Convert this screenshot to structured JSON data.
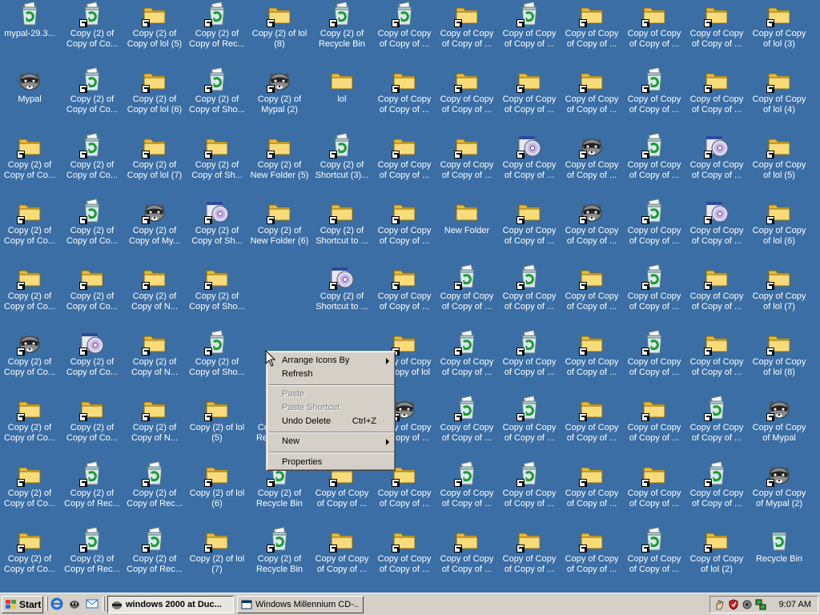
{
  "desktop": {
    "background_color": "#3a6ea5",
    "grid": [
      [
        [
          "recycle_full",
          "mypal-29.3...",
          false
        ],
        [
          "recycle_full",
          "Copy (2) of Copy of Co...",
          true
        ],
        [
          "folder",
          "Copy (2) of Copy of lol (5)",
          true
        ],
        [
          "recycle_full",
          "Copy (2) of Copy of Rec...",
          true
        ],
        [
          "folder",
          "Copy (2) of lol (8)",
          true
        ],
        [
          "recycle_full",
          "Copy (2) of Recycle Bin (8)",
          true
        ],
        [
          "recycle_full",
          "Copy of Copy of Copy of ...",
          true
        ],
        [
          "folder",
          "Copy of Copy of Copy of ...",
          true
        ],
        [
          "recycle_full",
          "Copy of Copy of Copy of ...",
          true
        ],
        [
          "folder",
          "Copy of Copy of Copy of ...",
          true
        ],
        [
          "folder",
          "Copy of Copy of Copy of ...",
          true
        ],
        [
          "folder",
          "Copy of Copy of Copy of ...",
          true
        ],
        [
          "folder",
          "Copy of Copy of lol (3)",
          true
        ]
      ],
      [
        [
          "raccoon",
          "Mypal",
          false
        ],
        [
          "recycle_full",
          "Copy (2) of Copy of Co...",
          true
        ],
        [
          "folder",
          "Copy (2) of Copy of lol (6)",
          true
        ],
        [
          "recycle_full",
          "Copy (2) of Copy of Sho...",
          true
        ],
        [
          "raccoon",
          "Copy (2) of Mypal (2)",
          true
        ],
        [
          "folder",
          "lol",
          false
        ],
        [
          "folder",
          "Copy of Copy of Copy of ...",
          true
        ],
        [
          "folder",
          "Copy of Copy of Copy of ...",
          true
        ],
        [
          "folder",
          "Copy of Copy of Copy of ...",
          true
        ],
        [
          "folder",
          "Copy of Copy of Copy of ...",
          true
        ],
        [
          "recycle_full",
          "Copy of Copy of Copy of ...",
          true
        ],
        [
          "folder",
          "Copy of Copy of Copy of ...",
          true
        ],
        [
          "folder",
          "Copy of Copy of lol (4)",
          true
        ]
      ],
      [
        [
          "folder",
          "Copy (2) of Copy of Co...",
          true
        ],
        [
          "recycle_full",
          "Copy (2) of Copy of Co...",
          true
        ],
        [
          "folder",
          "Copy (2) of Copy of lol (7)",
          true
        ],
        [
          "folder",
          "Copy (2) of Copy of Sh...",
          true
        ],
        [
          "folder",
          "Copy (2) of New Folder (5)",
          true
        ],
        [
          "recycle_full",
          "Copy (2) of Shortcut (3)...",
          true
        ],
        [
          "folder",
          "Copy of Copy of Copy of ...",
          true
        ],
        [
          "folder",
          "Copy of Copy of Copy of ...",
          true
        ],
        [
          "cd",
          "Copy of Copy of Copy of ...",
          true
        ],
        [
          "raccoon",
          "Copy of Copy of Copy of ...",
          true
        ],
        [
          "recycle_full",
          "Copy of Copy of Copy of ...",
          true
        ],
        [
          "cd",
          "Copy of Copy of Copy of ...",
          true
        ],
        [
          "folder",
          "Copy of Copy of lol (5)",
          true
        ]
      ],
      [
        [
          "folder",
          "Copy (2) of Copy of Co...",
          true
        ],
        [
          "recycle_full",
          "Copy (2) of Copy of Co...",
          true
        ],
        [
          "raccoon",
          "Copy (2) of Copy of My...",
          true
        ],
        [
          "cd",
          "Copy (2) of Copy of Sh...",
          true
        ],
        [
          "folder",
          "Copy (2) of New Folder (6)",
          true
        ],
        [
          "folder",
          "Copy (2) of Shortcut to ...",
          true
        ],
        [
          "folder",
          "Copy of Copy of Copy of ...",
          true
        ],
        [
          "folder",
          "New Folder",
          false
        ],
        [
          "folder",
          "Copy of Copy of Copy of ...",
          true
        ],
        [
          "raccoon",
          "Copy of Copy of Copy of ...",
          true
        ],
        [
          "recycle_full",
          "Copy of Copy of Copy of ...",
          true
        ],
        [
          "cd",
          "Copy of Copy of Copy of ...",
          true
        ],
        [
          "folder",
          "Copy of Copy of lol (6)",
          true
        ]
      ],
      [
        [
          "folder",
          "Copy (2) of Copy of Co...",
          true
        ],
        [
          "folder",
          "Copy (2) of Copy of Co...",
          true
        ],
        [
          "folder",
          "Copy (2) of Copy of N...",
          true
        ],
        [
          "folder",
          "Copy (2) of Copy of Sho...",
          true
        ],
        null,
        [
          "cd",
          "Copy (2) of Shortcut to ...",
          true
        ],
        [
          "folder",
          "Copy of Copy of Copy of ...",
          true
        ],
        [
          "recycle_full",
          "Copy of Copy of Copy of ...",
          true
        ],
        [
          "recycle_full",
          "Copy of Copy of Copy of ...",
          true
        ],
        [
          "folder",
          "Copy of Copy of Copy of ...",
          true
        ],
        [
          "recycle_full",
          "Copy of Copy of Copy of ...",
          true
        ],
        [
          "folder",
          "Copy of Copy of Copy of ...",
          true
        ],
        [
          "folder",
          "Copy of Copy of lol (7)",
          true
        ]
      ],
      [
        [
          "raccoon",
          "Copy (2) of Copy of Co...",
          true
        ],
        [
          "cd",
          "Copy (2) of Copy of Co...",
          true
        ],
        [
          "folder",
          "Copy (2) of Copy of N...",
          true
        ],
        [
          "recycle_full",
          "Copy (2) of Copy of Sho...",
          true
        ],
        null,
        null,
        [
          "folder",
          "Copy of Copy of Copy of lol (7)",
          true
        ],
        [
          "recycle_full",
          "Copy of Copy of Copy of ...",
          true
        ],
        [
          "recycle_full",
          "Copy of Copy of Copy of ...",
          true
        ],
        [
          "folder",
          "Copy of Copy of Copy of ...",
          true
        ],
        [
          "recycle_full",
          "Copy of Copy of Copy of ...",
          true
        ],
        [
          "folder",
          "Copy of Copy of Copy of ...",
          true
        ],
        [
          "folder",
          "Copy of Copy of lol (8)",
          true
        ]
      ],
      [
        [
          "folder",
          "Copy (2) of Copy of Co...",
          true
        ],
        [
          "folder",
          "Copy (2) of Copy of Co...",
          true
        ],
        [
          "folder",
          "Copy (2) of Copy of N...",
          true
        ],
        [
          "folder",
          "Copy (2) of lol (5)",
          true
        ],
        [
          "recycle_full",
          "Copy (2) of Recycle Bin (5)",
          true
        ],
        null,
        [
          "raccoon",
          "Copy of Copy of Copy of ...",
          true
        ],
        [
          "recycle_full",
          "Copy of Copy of Copy of ...",
          true
        ],
        [
          "recycle_full",
          "Copy of Copy of Copy of ...",
          true
        ],
        [
          "folder",
          "Copy of Copy of Copy of ...",
          true
        ],
        [
          "folder",
          "Copy of Copy of Copy of ...",
          true
        ],
        [
          "recycle_full",
          "Copy of Copy of Copy of ...",
          true
        ],
        [
          "raccoon",
          "Copy of Copy of Mypal",
          true
        ]
      ],
      [
        [
          "folder",
          "Copy (2) of Copy of Co...",
          true
        ],
        [
          "recycle_full",
          "Copy (2) of Copy of Rec...",
          true
        ],
        [
          "recycle_full",
          "Copy (2) of Copy of Rec...",
          true
        ],
        [
          "folder",
          "Copy (2) of lol (6)",
          true
        ],
        [
          "recycle_full",
          "Copy (2) of Recycle Bin (6)",
          true
        ],
        [
          "folder",
          "Copy of Copy of Copy of ...",
          true
        ],
        [
          "folder",
          "Copy of Copy of Copy of ...",
          true
        ],
        [
          "recycle_full",
          "Copy of Copy of Copy of ...",
          true
        ],
        [
          "recycle_full",
          "Copy of Copy of Copy of ...",
          true
        ],
        [
          "folder",
          "Copy of Copy of Copy of ...",
          true
        ],
        [
          "folder",
          "Copy of Copy of Copy of ...",
          true
        ],
        [
          "recycle_full",
          "Copy of Copy of Copy of ...",
          true
        ],
        [
          "raccoon",
          "Copy of Copy of Mypal (2)",
          true
        ]
      ],
      [
        [
          "folder",
          "Copy (2) of Copy of Co...",
          true
        ],
        [
          "recycle_full",
          "Copy (2) of Copy of Rec...",
          true
        ],
        [
          "recycle_full",
          "Copy (2) of Copy of Rec...",
          true
        ],
        [
          "folder",
          "Copy (2) of lol (7)",
          true
        ],
        [
          "recycle_full",
          "Copy (2) of Recycle Bin (7)",
          true
        ],
        [
          "folder",
          "Copy of Copy of Copy of ...",
          true
        ],
        [
          "folder",
          "Copy of Copy of Copy of ...",
          true
        ],
        [
          "folder",
          "Copy of Copy of Copy of ...",
          true
        ],
        [
          "folder",
          "Copy of Copy of Copy of ...",
          true
        ],
        [
          "folder",
          "Copy of Copy of Copy of ...",
          true
        ],
        [
          "recycle_full",
          "Copy of Copy of Copy of ...",
          true
        ],
        [
          "folder",
          "Copy of Copy of lol (2)",
          true
        ],
        [
          "recycle_empty",
          "Recycle Bin",
          false
        ]
      ]
    ]
  },
  "context_menu": {
    "arrange": "Arrange Icons By",
    "refresh": "Refresh",
    "paste": "Paste",
    "paste_shortcut": "Paste Shortcut",
    "undo_delete": "Undo Delete",
    "undo_delete_key": "Ctrl+Z",
    "new": "New",
    "properties": "Properties"
  },
  "taskbar": {
    "start_label": "Start",
    "tasks": [
      {
        "label": "windows 2000 at Duc...",
        "icon": "raccoon-icon",
        "active": true
      },
      {
        "label": "Windows Millennium CD-...",
        "icon": "cd-window-icon",
        "active": false
      }
    ],
    "quick_launch": [
      "ie-icon",
      "mypal-icon",
      "outlook-express-icon"
    ],
    "tray_icons": [
      "hand-icon",
      "shield-icon",
      "speaker-icon",
      "network-icon"
    ],
    "clock": "9:07 AM"
  },
  "colors": {
    "desktop": "#3a6ea5",
    "taskbar": "#d4d0c8",
    "folder": "#f4d36b"
  }
}
